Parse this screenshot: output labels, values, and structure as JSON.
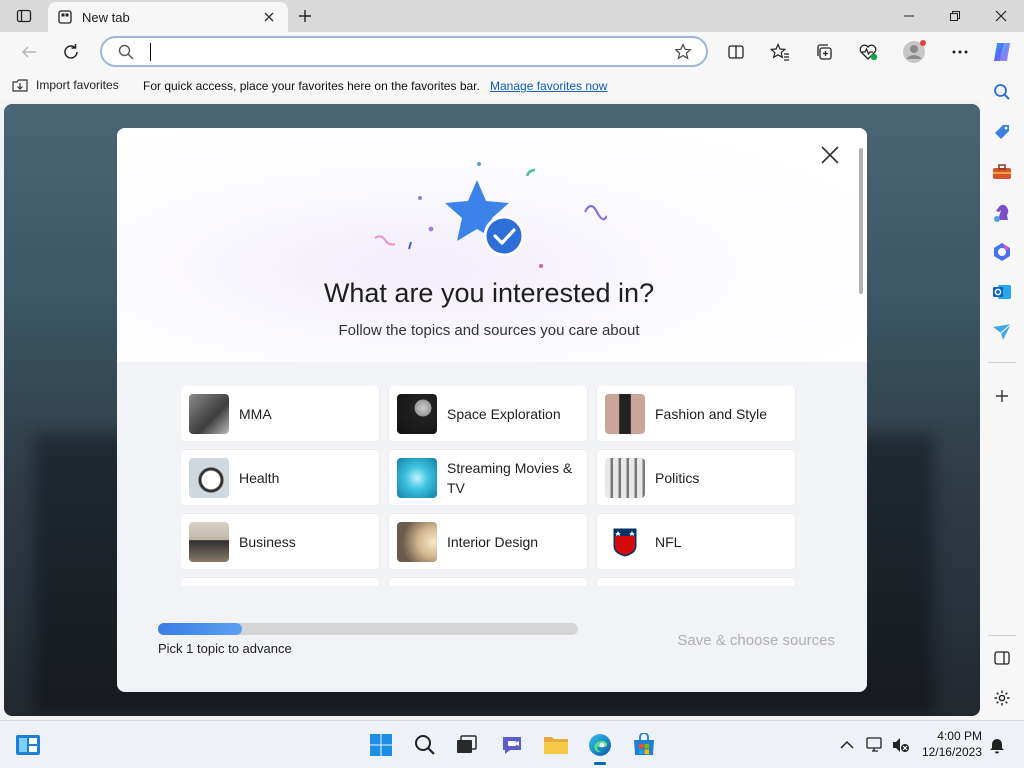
{
  "browser": {
    "tab": {
      "title": "New tab"
    },
    "address": {
      "value": "",
      "placeholder": ""
    },
    "favorites_bar": {
      "import_label": "Import favorites",
      "message": "For quick access, place your favorites here on the favorites bar.",
      "manage_link": "Manage favorites now"
    },
    "accent": "#0f6cbd"
  },
  "modal": {
    "title": "What are you interested in?",
    "subtitle": "Follow the topics and sources you care about",
    "topics": [
      {
        "label": "MMA",
        "icon": "mma-photo"
      },
      {
        "label": "Space Exploration",
        "icon": "space-photo"
      },
      {
        "label": "Fashion and Style",
        "icon": "fashion-photo"
      },
      {
        "label": "Health",
        "icon": "stethoscope-photo"
      },
      {
        "label": "Streaming Movies & TV",
        "icon": "streaming-photo"
      },
      {
        "label": "Politics",
        "icon": "columns-photo"
      },
      {
        "label": "Business",
        "icon": "business-photo"
      },
      {
        "label": "Interior Design",
        "icon": "interior-photo"
      },
      {
        "label": "NFL",
        "icon": "nfl-logo"
      }
    ],
    "progress": {
      "fraction": 0.2,
      "text": "Pick 1 topic to advance"
    },
    "save_button": "Save & choose sources"
  },
  "taskbar": {
    "time": "4:00 PM",
    "date": "12/16/2023"
  }
}
